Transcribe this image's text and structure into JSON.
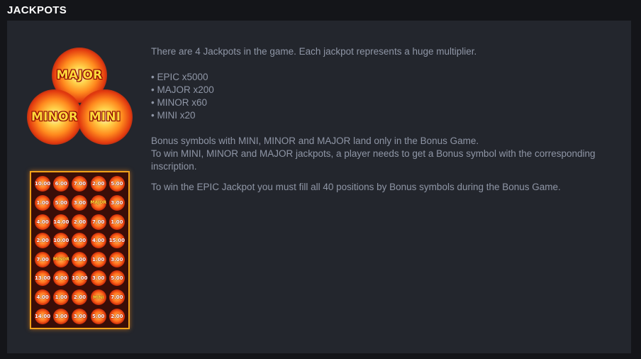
{
  "header": {
    "title": "JACKPOTS"
  },
  "jackpot_badges": {
    "major": "MAJOR",
    "minor": "MINOR",
    "mini": "MINI"
  },
  "info": {
    "intro": "There are 4 Jackpots in the game. Each jackpot represents a huge multiplier.",
    "multipliers": [
      "• EPIC x5000",
      "• MAJOR x200",
      "• MINOR x60",
      "• MINI x20"
    ],
    "bonus_line_1": "Bonus symbols with MINI, MINOR and MAJOR land only in the Bonus Game.",
    "bonus_line_2": "To win MINI, MINOR and MAJOR jackpots, a player needs to get a Bonus symbol with the corresponding inscription.",
    "epic_rule": "To win the EPIC Jackpot you must fill all 40 positions by Bonus symbols during the Bonus Game."
  },
  "bonus_grid": {
    "rows": [
      [
        "10.00",
        "6.00",
        "7.00",
        "2.00",
        "5.00"
      ],
      [
        "1.00",
        "5.00",
        "3.00",
        "MAJOR",
        "3.00"
      ],
      [
        "4.00",
        "14.00",
        "2.00",
        "7.00",
        "1.00"
      ],
      [
        "2.00",
        "10.00",
        "6.00",
        "4.00",
        "15.00"
      ],
      [
        "7.00",
        "MINOR",
        "4.00",
        "1.00",
        "3.00"
      ],
      [
        "13.00",
        "6.00",
        "10.00",
        "3.00",
        "5.00"
      ],
      [
        "4.00",
        "1.00",
        "2.00",
        "MINI",
        "7.00"
      ],
      [
        "14.00",
        "3.00",
        "3.00",
        "5.00",
        "2.00"
      ]
    ]
  },
  "colors": {
    "background": "#141519",
    "panel": "#23262d",
    "text": "#8f96a6",
    "title": "#ffffff",
    "frame": "#f2a21a"
  }
}
